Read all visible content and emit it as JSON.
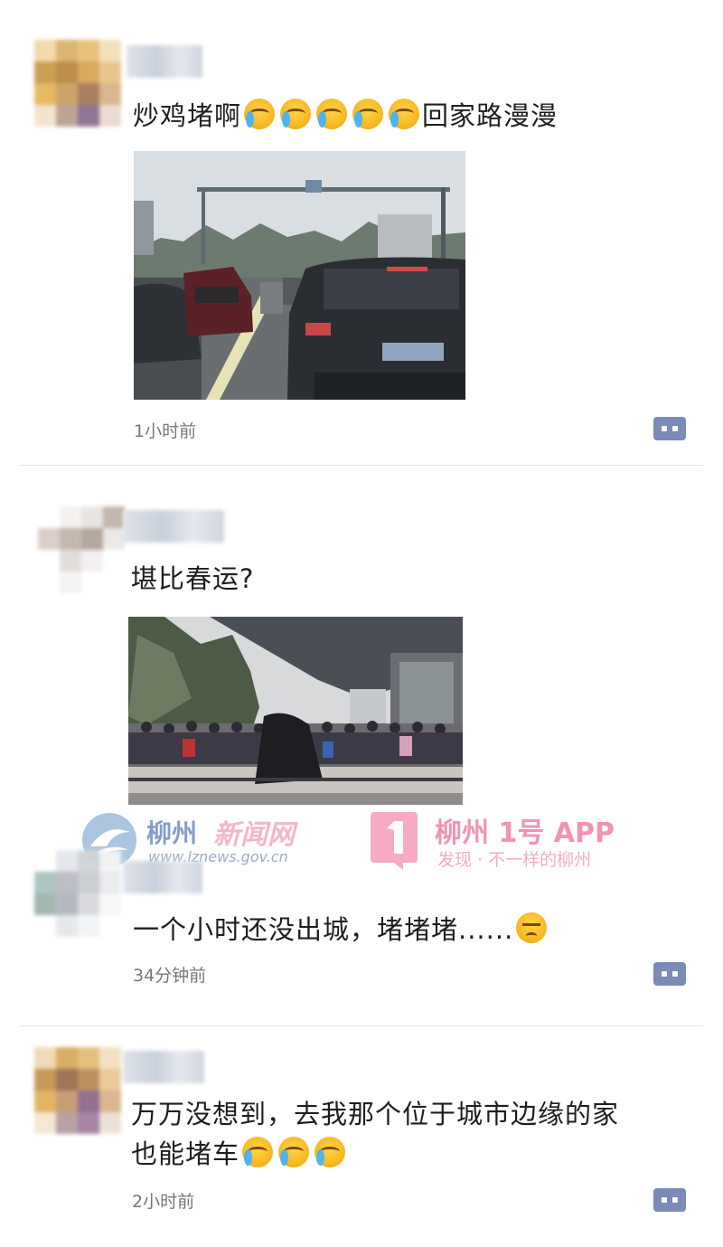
{
  "posts": [
    {
      "text": "炒鸡堵啊",
      "text_after_emoji": "回家路漫漫",
      "emoji_count": 5,
      "time": "1小时前"
    },
    {
      "text": "堪比春运?"
    },
    {
      "text": "一个小时还没出城，堵堵堵......",
      "time": "34分钟前"
    },
    {
      "text_line1": "万万没想到，去我那个位于城市边缘的家",
      "text_line2": "也能堵车",
      "emoji_count": 3,
      "time": "2小时前"
    }
  ],
  "watermark": {
    "left_brand": "柳州",
    "left_brand_stylized": "新闻网",
    "left_url": "www.lznews.gov.cn",
    "right_title": "柳州 1号 APP",
    "right_slogan": "发现 · 不一样的柳州"
  },
  "icons": {
    "comment": "comment-dots-icon",
    "crying_laughing": "face-with-tears-of-joy-icon",
    "pensive": "pensive-face-icon"
  },
  "colors": {
    "comment_button": "#7b8bb8",
    "watermark_pink": "#f06f9a",
    "watermark_blue": "#5a7fb5"
  }
}
